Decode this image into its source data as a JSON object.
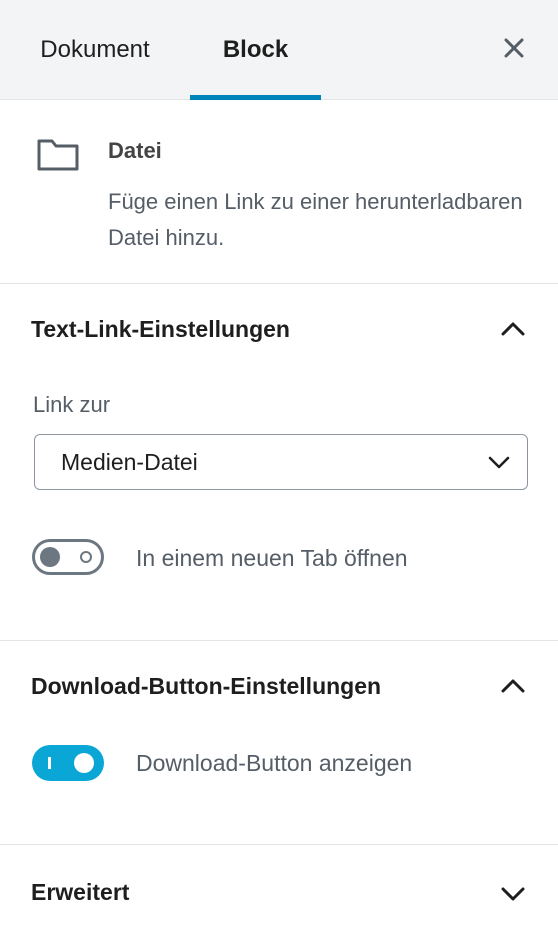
{
  "tabs": {
    "document": "Dokument",
    "block": "Block"
  },
  "block_info": {
    "title": "Datei",
    "description": "Füge einen Link zu einer herunterladbaren Datei hinzu."
  },
  "text_link_panel": {
    "title": "Text-Link-Einstellungen",
    "link_to_label": "Link zur",
    "link_to_value": "Medien-Datei",
    "new_tab_label": "In einem neuen Tab öffnen",
    "new_tab_enabled": false
  },
  "download_panel": {
    "title": "Download-Button-Einstellungen",
    "show_button_label": "Download-Button anzeigen",
    "show_button_enabled": true
  },
  "advanced_panel": {
    "title": "Erweitert"
  },
  "colors": {
    "accent": "#0085ba",
    "toggle_on": "#0aa6d6"
  },
  "icons": [
    "close-icon",
    "folder-icon",
    "chevron-up-icon",
    "chevron-down-icon"
  ]
}
